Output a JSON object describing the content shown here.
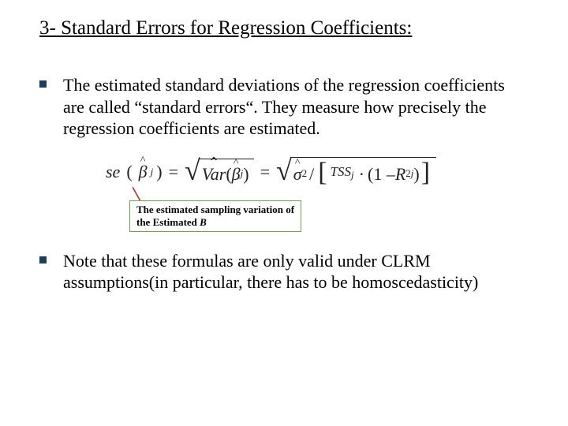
{
  "title": "3- Standard Errors for Regression Coefficients:",
  "bullets": {
    "b1": "The estimated standard deviations of the regression coefficients are called “standard errors“. They measure how precisely the regression coefficients are estimated.",
    "b2": "Note that these formulas are only valid under CLRM assumptions(in particular, there has to be homoscedasticity)"
  },
  "formula": {
    "se": "se",
    "lp": "(",
    "rp": ")",
    "beta": "β",
    "sub_j": "j",
    "eq": " = ",
    "var": "Var",
    "sigma": "σ",
    "sq": "2",
    "slash": "/",
    "tss": "TSS",
    "dot": "·",
    "lb": "[",
    "rb": "]",
    "one_minus": "(1 – ",
    "r": "R",
    "rp2": ")"
  },
  "caption": {
    "l1": "The estimated sampling variation of",
    "l2a": "the Estimated ",
    "l2b": "B"
  }
}
